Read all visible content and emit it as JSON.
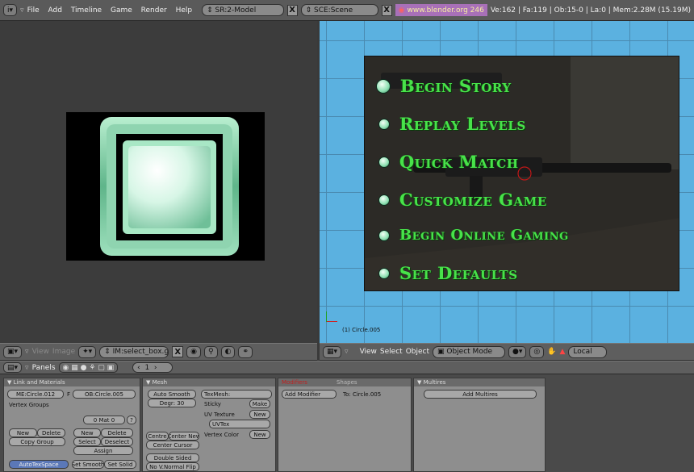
{
  "topbar": {
    "menus": [
      "File",
      "Add",
      "Timeline",
      "Game",
      "Render",
      "Help"
    ],
    "screen_field": "SR:2-Model",
    "scene_field": "SCE:Scene",
    "url": "www.blender.org 246",
    "stats": "Ve:162 | Fa:119 | Ob:15-0 | La:0  | Mem:2.28M (15.19M)"
  },
  "game_menu": {
    "items": [
      "Begin Story",
      "Replay Levels",
      "Quick Match",
      "Customize Game",
      "Begin Online Gaming",
      "Set Defaults"
    ]
  },
  "viewport": {
    "object_label": "(1) Circle.005",
    "header": {
      "view": "View",
      "select": "Select",
      "object": "Object",
      "mode": "Object Mode",
      "orientation": "Local"
    }
  },
  "image_header": {
    "view": "View",
    "image": "Image",
    "image_field": "IM:select_box.gif"
  },
  "buttons_header": {
    "panels": "Panels",
    "frame": "1"
  },
  "panel_link": {
    "title": "Link and Materials",
    "me_field": "ME:Circle.012",
    "ob_field": "OB:Circle.005",
    "f_label": "F",
    "vertex_groups": "Vertex Groups",
    "mat_field": "0 Mat 0",
    "q_btn": "?",
    "new": "New",
    "delete": "Delete",
    "copy_group": "Copy Group",
    "new2": "New",
    "delete2": "Delete",
    "select": "Select",
    "deselect": "Deselect",
    "assign": "Assign",
    "autotexspace": "AutoTexSpace",
    "set_smooth": "Set Smooth",
    "set_solid": "Set Solid"
  },
  "panel_mesh": {
    "title": "Mesh",
    "auto_smooth": "Auto Smooth",
    "degr": "Degr: 30",
    "centre": "Centre",
    "center_new": "Center New",
    "center_cursor": "Center Cursor",
    "double_sided": "Double Sided",
    "no_v_normal_flip": "No V.Normal Flip",
    "texmesh": "TexMesh:",
    "sticky": "Sticky",
    "make": "Make",
    "uv_texture": "UV Texture",
    "new": "New",
    "uvtex": "UVTex",
    "vertex_color": "Vertex Color",
    "new2": "New"
  },
  "panel_modifiers": {
    "tab_modifiers": "Modifiers",
    "tab_shapes": "Shapes",
    "add_modifier": "Add Modifier",
    "to_label": "To: Circle.005"
  },
  "panel_multires": {
    "title": "Multires",
    "add_multires": "Add Multires"
  },
  "colors": {
    "viewport_bg": "#5bb1e0",
    "menu_green": "#48e24a"
  }
}
